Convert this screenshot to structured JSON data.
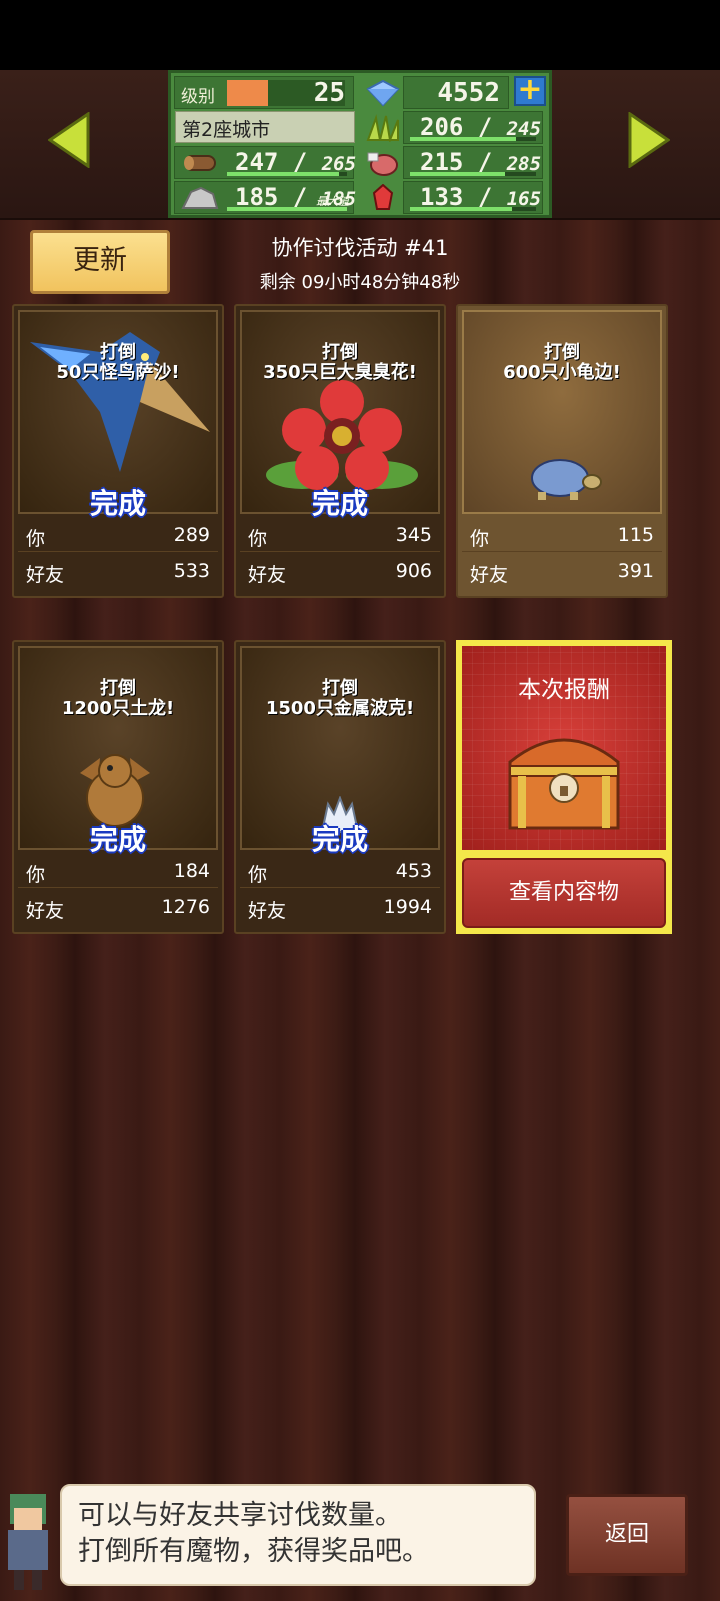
{
  "header": {
    "level_label": "级别",
    "level": "25",
    "level_progress": 0.35,
    "gems": "4552",
    "plus_label": "+",
    "city_name": "第2座城市",
    "resources": [
      {
        "icon": "wood-log-icon",
        "value": "247",
        "max": "265",
        "fill": 0.93
      },
      {
        "icon": "stone-ore-icon",
        "value": "185",
        "max": "185",
        "max_note": "最大值",
        "fill": 1.0
      },
      {
        "icon": "grass-bundle-icon",
        "value": "206",
        "max": "245",
        "fill": 0.84
      },
      {
        "icon": "meat-icon",
        "value": "215",
        "max": "285",
        "fill": 0.75
      },
      {
        "icon": "red-crystal-icon",
        "value": "133",
        "max": "165",
        "fill": 0.81
      }
    ]
  },
  "refresh_label": "更新",
  "event": {
    "title": "协作讨伐活动 #41",
    "remaining": "剩余 09小时48分钟48秒"
  },
  "cards": [
    {
      "line1": "打倒",
      "line2": "50只怪鸟萨沙!",
      "status": "完成",
      "you_label": "你",
      "you": "289",
      "friend_label": "好友",
      "friend": "533"
    },
    {
      "line1": "打倒",
      "line2": "350只巨大臭臭花!",
      "status": "完成",
      "you_label": "你",
      "you": "345",
      "friend_label": "好友",
      "friend": "906"
    },
    {
      "line1": "打倒",
      "line2": "600只小龟边!",
      "status": "",
      "you_label": "你",
      "you": "115",
      "friend_label": "好友",
      "friend": "391"
    },
    {
      "line1": "打倒",
      "line2": "1200只土龙!",
      "status": "完成",
      "you_label": "你",
      "you": "184",
      "friend_label": "好友",
      "friend": "1276"
    },
    {
      "line1": "打倒",
      "line2": "1500只金属波克!",
      "status": "完成",
      "you_label": "你",
      "you": "453",
      "friend_label": "好友",
      "friend": "1994"
    }
  ],
  "reward": {
    "title": "本次报酬",
    "button": "查看内容物"
  },
  "dialog": {
    "line1": "可以与好友共享讨伐数量。",
    "line2": "打倒所有魔物，获得奖品吧。"
  },
  "back_label": "返回",
  "colors": {
    "accent_green": "#4a8a3e",
    "arrow_yellow": "#c8e03a",
    "done_blue": "#1a3ac0",
    "reward_red": "#c4413a"
  }
}
